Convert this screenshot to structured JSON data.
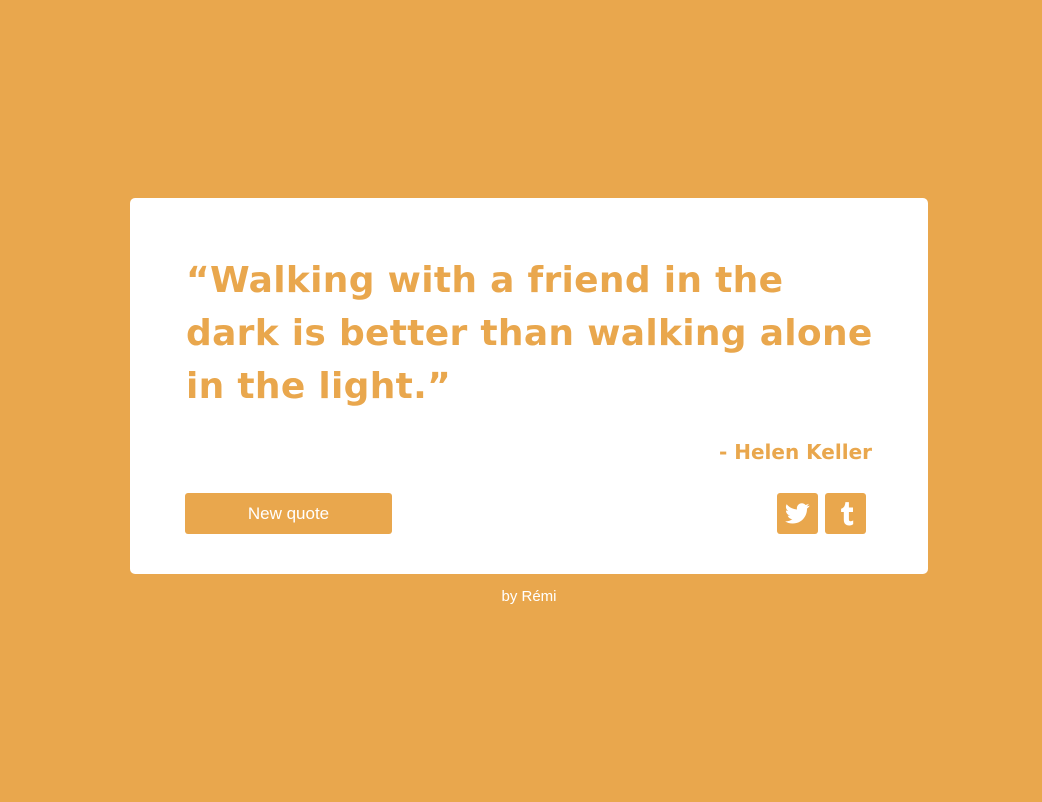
{
  "quote": {
    "text": "“Walking with a friend in the dark is better than walking alone in the light.”",
    "author": "- Helen Keller"
  },
  "actions": {
    "new_quote_label": "New quote",
    "twitter_icon": "twitter-icon",
    "tumblr_icon": "tumblr-icon"
  },
  "footer": {
    "credit": "by Rémi"
  },
  "colors": {
    "accent": "#e9a74d",
    "card": "#ffffff"
  }
}
